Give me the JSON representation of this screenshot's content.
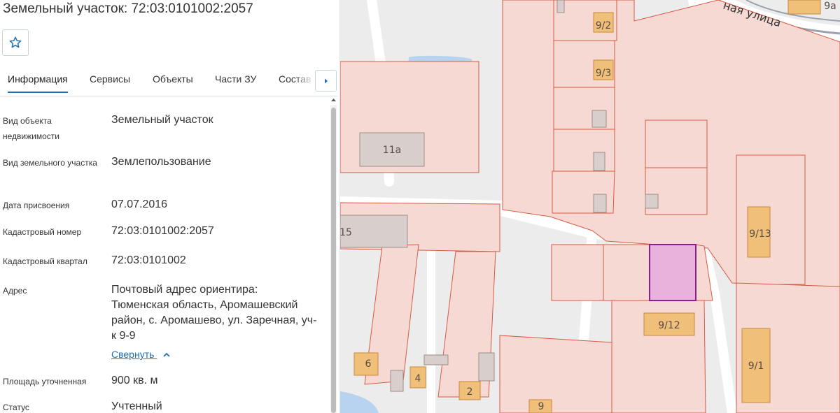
{
  "panel": {
    "title": "Земельный участок: 72:03:0101002:2057",
    "favorite_icon": "star-outline-icon",
    "tabs": [
      {
        "label": "Информация",
        "active": true
      },
      {
        "label": "Сервисы",
        "active": false
      },
      {
        "label": "Объекты",
        "active": false
      },
      {
        "label": "Части ЗУ",
        "active": false
      },
      {
        "label": "Состав",
        "active": false
      }
    ],
    "tabs_more_icon": "chevron-right-icon",
    "properties": [
      {
        "label": "Вид объекта недвижимости",
        "value": "Земельный участок"
      },
      {
        "label": "Вид земельного участка",
        "value": "Землепользование"
      },
      {
        "label": "Дата присвоения",
        "value": "07.07.2016"
      },
      {
        "label": "Кадастровый номер",
        "value": "72:03:0101002:2057"
      },
      {
        "label": "Кадастровый квартал",
        "value": "72:03:0101002"
      },
      {
        "label": "Адрес",
        "value": "Почтовый адрес ориентира: Тюменская область, Аромашевский район, с. Аромашево, ул. Заречная, уч-к 9-9"
      },
      {
        "label": "Площадь уточненная",
        "value": "900 кв. м"
      },
      {
        "label": "Статус",
        "value": "Учтенный"
      }
    ],
    "collapse_link": "Свернуть",
    "collapse_icon": "chevron-up-icon"
  },
  "map": {
    "street_label": "ная улица",
    "labels": [
      "9а",
      "9/2",
      "9/3",
      "11а",
      "15",
      "9/13",
      "9/12",
      "9/1",
      "6",
      "4",
      "2",
      "9"
    ],
    "colors": {
      "parcel_fill": "#f7d9d3",
      "parcel_stroke": "#d65a45",
      "building_fill": "#f0c07a",
      "selected_fill": "#e8b2dc",
      "selected_stroke": "#8a1f8f",
      "water": "#b7d3f0",
      "road": "#ffffff"
    }
  }
}
